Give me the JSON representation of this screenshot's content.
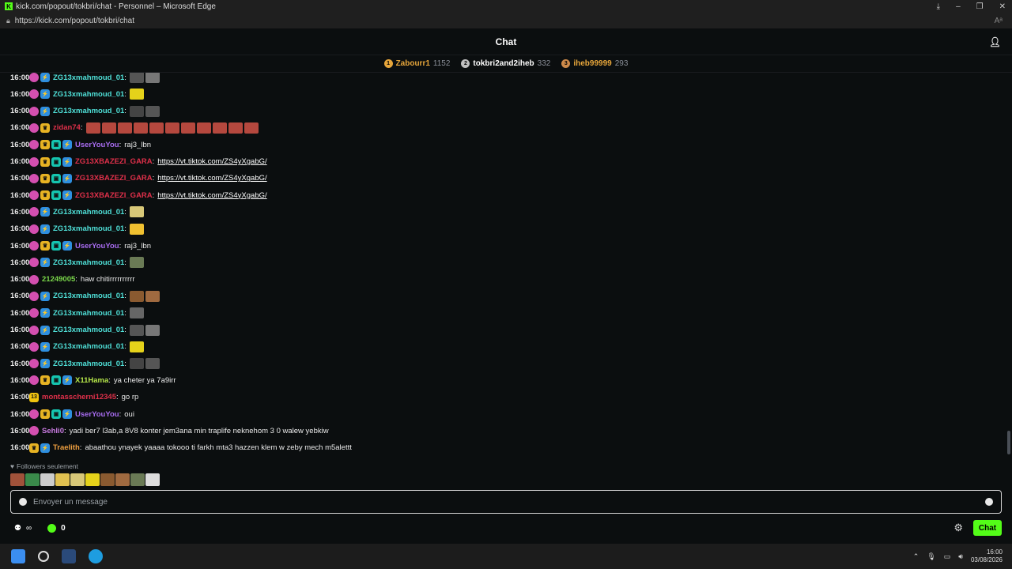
{
  "browser": {
    "title": "kick.com/popout/tokbri/chat - Personnel – Microsoft Edge",
    "url": "https://kick.com/popout/tokbri/chat",
    "reader_label": "Aᵃ"
  },
  "header": {
    "title": "Chat"
  },
  "leaderboard": [
    {
      "rank": "1",
      "name": "Zabourr1",
      "count": "1152",
      "color": "#e7a63b",
      "name_color": "#e7a63b"
    },
    {
      "rank": "2",
      "name": "tokbri2and2iheb",
      "count": "332",
      "color": "#c0c0c0",
      "name_color": "#ffffff"
    },
    {
      "rank": "3",
      "name": "iheb99999",
      "count": "293",
      "color": "#cd8a4a",
      "name_color": "#e7a63b"
    }
  ],
  "messages": [
    {
      "time": "16:00",
      "user": "ZG13xmahmoud_01",
      "color": "#4fe0d8",
      "badges": [
        "sub",
        "vip"
      ],
      "emotes": [
        "#555",
        "#777"
      ]
    },
    {
      "time": "16:00",
      "user": "ZG13xmahmoud_01",
      "color": "#4fe0d8",
      "badges": [
        "sub",
        "vip"
      ],
      "emotes": [
        "#e5d21a"
      ]
    },
    {
      "time": "16:00",
      "user": "ZG13xmahmoud_01",
      "color": "#4fe0d8",
      "badges": [
        "sub",
        "vip"
      ],
      "emotes": [
        "#444",
        "#555"
      ]
    },
    {
      "time": "16:00",
      "user": "zidan74",
      "color": "#e0304a",
      "badges": [
        "sub",
        "crown"
      ],
      "emotes": [
        "#b5483e",
        "#b5483e",
        "#b5483e",
        "#b5483e",
        "#b5483e",
        "#b5483e",
        "#b5483e",
        "#b5483e",
        "#b5483e",
        "#b5483e",
        "#b5483e"
      ]
    },
    {
      "time": "16:00",
      "user": "UserYouYou",
      "color": "#a86cf0",
      "badges": [
        "sub",
        "crown",
        "mod",
        "vip"
      ],
      "text": "raj3_lbn"
    },
    {
      "time": "16:00",
      "user": "ZG13XBAZEZI_GARA",
      "color": "#e0304a",
      "badges": [
        "sub",
        "crown",
        "mod",
        "vip"
      ],
      "link": "https://vt.tiktok.com/ZS4yXgabG/"
    },
    {
      "time": "16:00",
      "user": "ZG13XBAZEZI_GARA",
      "color": "#e0304a",
      "badges": [
        "sub",
        "crown",
        "mod",
        "vip"
      ],
      "link": "https://vt.tiktok.com/ZS4yXgabG/"
    },
    {
      "time": "16:00",
      "user": "ZG13XBAZEZI_GARA",
      "color": "#e0304a",
      "badges": [
        "sub",
        "crown",
        "mod",
        "vip"
      ],
      "link": "https://vt.tiktok.com/ZS4yXgabG/"
    },
    {
      "time": "16:00",
      "user": "ZG13xmahmoud_01",
      "color": "#4fe0d8",
      "badges": [
        "sub",
        "vip"
      ],
      "emotes": [
        "#d8c878"
      ]
    },
    {
      "time": "16:00",
      "user": "ZG13xmahmoud_01",
      "color": "#4fe0d8",
      "badges": [
        "sub",
        "vip"
      ],
      "emotes": [
        "#f0c030"
      ]
    },
    {
      "time": "16:00",
      "user": "UserYouYou",
      "color": "#a86cf0",
      "badges": [
        "sub",
        "crown",
        "mod",
        "vip"
      ],
      "text": "raj3_lbn"
    },
    {
      "time": "16:00",
      "user": "ZG13xmahmoud_01",
      "color": "#4fe0d8",
      "badges": [
        "sub",
        "vip"
      ],
      "emotes": [
        "#6a7a55"
      ]
    },
    {
      "time": "16:00",
      "user": "21249005",
      "color": "#7ad74a",
      "badges": [
        "sub"
      ],
      "text": "haw chitirrrrrrrrrr"
    },
    {
      "time": "16:00",
      "user": "ZG13xmahmoud_01",
      "color": "#4fe0d8",
      "badges": [
        "sub",
        "vip"
      ],
      "emotes": [
        "#8a5a30",
        "#a06a40"
      ]
    },
    {
      "time": "16:00",
      "user": "ZG13xmahmoud_01",
      "color": "#4fe0d8",
      "badges": [
        "sub",
        "vip"
      ],
      "emotes": [
        "#666"
      ]
    },
    {
      "time": "16:00",
      "user": "ZG13xmahmoud_01",
      "color": "#4fe0d8",
      "badges": [
        "sub",
        "vip"
      ],
      "emotes": [
        "#555",
        "#777"
      ]
    },
    {
      "time": "16:00",
      "user": "ZG13xmahmoud_01",
      "color": "#4fe0d8",
      "badges": [
        "sub",
        "vip"
      ],
      "emotes": [
        "#e5d21a"
      ]
    },
    {
      "time": "16:00",
      "user": "ZG13xmahmoud_01",
      "color": "#4fe0d8",
      "badges": [
        "sub",
        "vip"
      ],
      "emotes": [
        "#444",
        "#555"
      ]
    },
    {
      "time": "16:00",
      "user": "X11Hama",
      "color": "#b7e84a",
      "badges": [
        "sub",
        "crown",
        "mod",
        "vip"
      ],
      "text": "ya cheter ya 7a9irr"
    },
    {
      "time": "16:00",
      "user": "montasscherni12345",
      "color": "#e0304a",
      "badges": [
        "13"
      ],
      "text": "go rp"
    },
    {
      "time": "16:00",
      "user": "UserYouYou",
      "color": "#a86cf0",
      "badges": [
        "sub",
        "crown",
        "mod",
        "vip"
      ],
      "text": "oui"
    },
    {
      "time": "16:00",
      "user": "Sehli0",
      "color": "#c87be0",
      "badges": [
        "sub"
      ],
      "text": "yadi ber7 l3ab,a 8V8 konter jem3ana min traplife neknehom 3 0 walew yebkiw"
    },
    {
      "time": "16:00",
      "user": "Traelith",
      "color": "#f0a040",
      "badges": [
        "crown",
        "vip"
      ],
      "text": "abaathou ynayek yaaaa tokooo ti farkh mta3 hazzen klem w zeby mech m5alettt"
    }
  ],
  "followers_label": "Followers seulement",
  "quick_emotes": [
    "#a0523a",
    "#3a8a4a",
    "#cccccc",
    "#e0c050",
    "#d8c878",
    "#e5d21a",
    "#8a5a30",
    "#a06a40",
    "#6a7a55",
    "#dddddd"
  ],
  "input": {
    "placeholder": "Envoyer un message"
  },
  "footer": {
    "points": "0",
    "send_label": "Chat",
    "infinity": "∞"
  },
  "taskbar": {
    "time": "16:00",
    "date": "03/08/2026"
  }
}
